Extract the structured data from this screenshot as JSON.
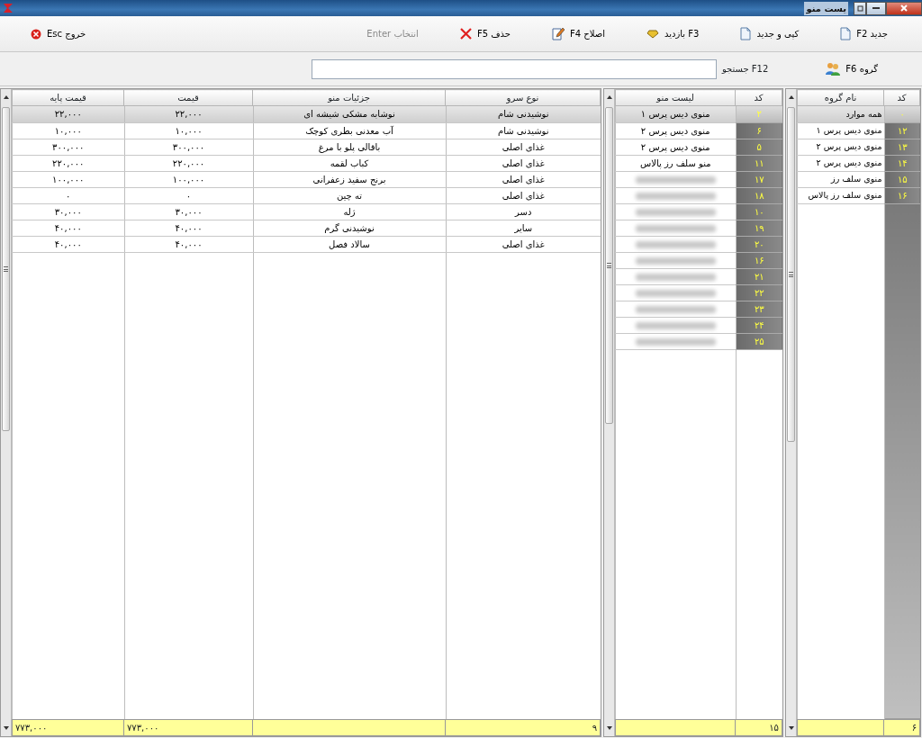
{
  "window": {
    "title": "یست منو"
  },
  "toolbar": [
    {
      "label": "جدید F2",
      "kind": "new",
      "disabled": false
    },
    {
      "label": "کپی و جدید",
      "kind": "copy",
      "disabled": false
    },
    {
      "label": "F3 بازدید",
      "kind": "view",
      "disabled": false
    },
    {
      "label": "اصلاح F4",
      "kind": "edit",
      "disabled": false
    },
    {
      "label": "حذف F5",
      "kind": "delete",
      "disabled": false
    },
    {
      "label": "انتخاب Enter",
      "kind": "select",
      "disabled": true
    },
    {
      "label": "خروج Esc",
      "kind": "exit",
      "disabled": false
    }
  ],
  "search": {
    "group_button": "گروه F6",
    "label": "F12 جستجو"
  },
  "groups": {
    "columns": [
      "کد",
      "نام گروه"
    ],
    "rows": [
      {
        "code": "۰",
        "name": "همه موارد",
        "selected": true
      },
      {
        "code": "۱۲",
        "name": "منوی دیس پرس ۱",
        "selected": false
      },
      {
        "code": "۱۳",
        "name": "منوی دیس پرس ۲",
        "selected": false
      },
      {
        "code": "۱۴",
        "name": "منوی دیس پرس ۲",
        "selected": false
      },
      {
        "code": "۱۵",
        "name": "منوی سلف رز",
        "selected": false
      },
      {
        "code": "۱۶",
        "name": "منوی سلف رز پالاس",
        "selected": false
      }
    ],
    "footer": "۶"
  },
  "menus": {
    "columns": [
      "کد",
      "لیست منو"
    ],
    "rows": [
      {
        "code": "۲",
        "name": "منوی دیس پرس ۱",
        "selected": true,
        "blurred": false
      },
      {
        "code": "۶",
        "name": "منوی دیس پرس ۲",
        "selected": false,
        "blurred": false
      },
      {
        "code": "۵",
        "name": "منوی دیس پرس ۲",
        "selected": false,
        "blurred": false
      },
      {
        "code": "۱۱",
        "name": "منو سلف رز پالاس",
        "selected": false,
        "blurred": false
      },
      {
        "code": "۱۷",
        "selected": false,
        "blurred": true
      },
      {
        "code": "۱۸",
        "selected": false,
        "blurred": true
      },
      {
        "code": "۱۰",
        "selected": false,
        "blurred": true
      },
      {
        "code": "۱۹",
        "selected": false,
        "blurred": true
      },
      {
        "code": "۲۰",
        "selected": false,
        "blurred": true
      },
      {
        "code": "۱۶",
        "selected": false,
        "blurred": true
      },
      {
        "code": "۲۱",
        "selected": false,
        "blurred": true
      },
      {
        "code": "۲۲",
        "selected": false,
        "blurred": true
      },
      {
        "code": "۲۳",
        "selected": false,
        "blurred": true
      },
      {
        "code": "۲۴",
        "selected": false,
        "blurred": true
      },
      {
        "code": "۲۵",
        "selected": false,
        "blurred": true
      }
    ],
    "footer": "۱۵"
  },
  "items": {
    "columns": [
      "نوع سرو",
      "جزئیات منو",
      "قیمت",
      "قیمت پایه"
    ],
    "rows": [
      {
        "cells": [
          "نوشیدنی شام",
          "نوشابه مشکی شیشه ای",
          "۲۲,۰۰۰",
          "۲۲,۰۰۰"
        ],
        "selected": true
      },
      {
        "cells": [
          "نوشیدنی شام",
          "آب معدنی بطری کوچک",
          "۱۰,۰۰۰",
          "۱۰,۰۰۰"
        ],
        "selected": false
      },
      {
        "cells": [
          "غذای اصلی",
          "باقالی پلو با مرغ",
          "۳۰۰,۰۰۰",
          "۳۰۰,۰۰۰"
        ],
        "selected": false
      },
      {
        "cells": [
          "غذای اصلی",
          "کباب لقمه",
          "۲۲۰,۰۰۰",
          "۲۲۰,۰۰۰"
        ],
        "selected": false
      },
      {
        "cells": [
          "غذای اصلی",
          "برنج سفید زعفرانی",
          "۱۰۰,۰۰۰",
          "۱۰۰,۰۰۰"
        ],
        "selected": false
      },
      {
        "cells": [
          "غذای اصلی",
          "ته چین",
          "۰",
          "۰"
        ],
        "selected": false
      },
      {
        "cells": [
          "دسر",
          "ژله",
          "۳۰,۰۰۰",
          "۳۰,۰۰۰"
        ],
        "selected": false
      },
      {
        "cells": [
          "سایر",
          "نوشیدنی گرم",
          "۴۰,۰۰۰",
          "۴۰,۰۰۰"
        ],
        "selected": false
      },
      {
        "cells": [
          "غذای اصلی",
          "سالاد فصل",
          "۴۰,۰۰۰",
          "۴۰,۰۰۰"
        ],
        "selected": false
      }
    ],
    "footer": {
      "count": "۹",
      "price_total": "۷۷۳,۰۰۰",
      "base_price_total": "۷۷۳,۰۰۰"
    }
  }
}
